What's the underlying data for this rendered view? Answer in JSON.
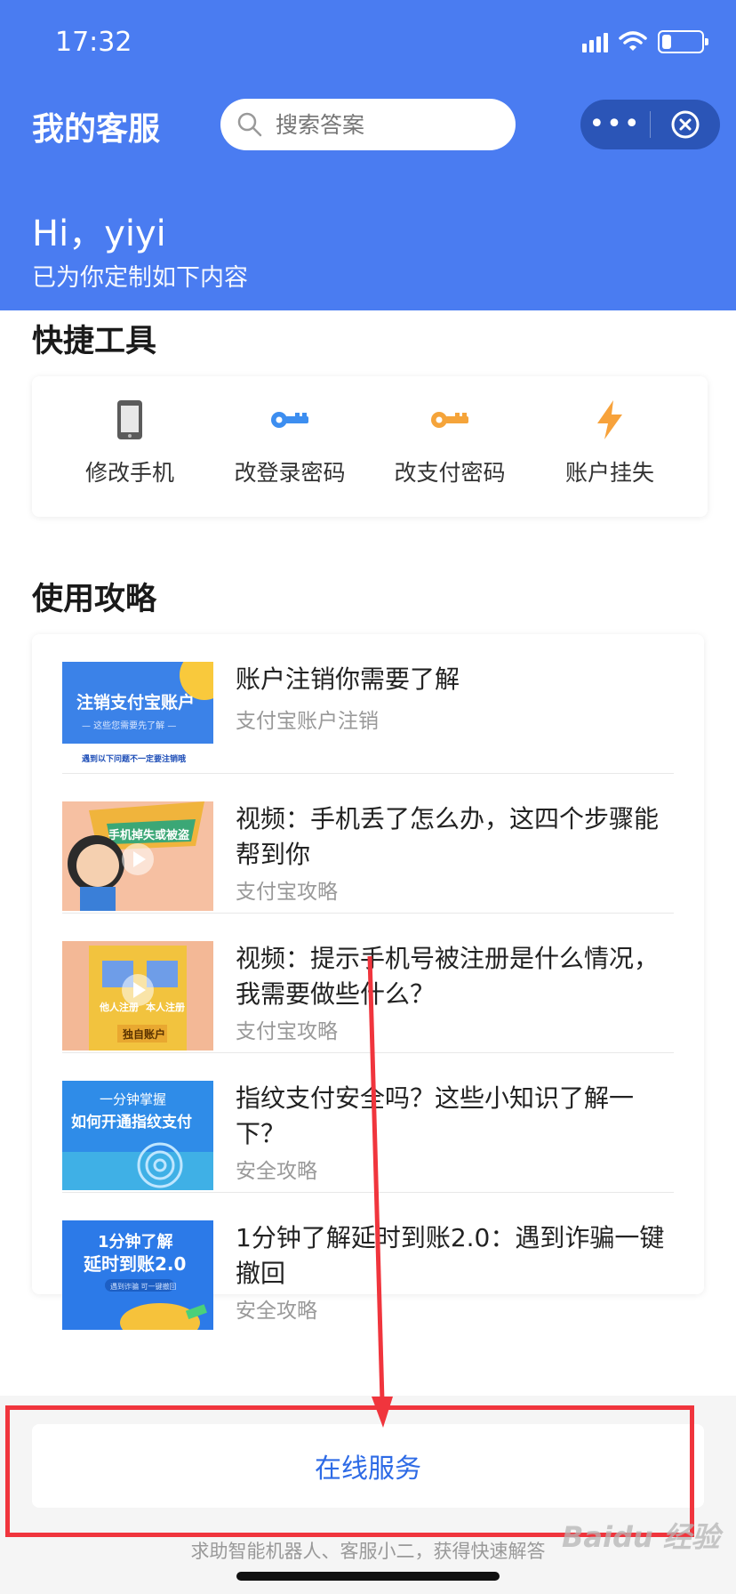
{
  "status_bar": {
    "time": "17:32"
  },
  "header": {
    "title": "我的客服",
    "search_placeholder": "搜索答案",
    "more_label": "•••"
  },
  "greeting": {
    "hello": "Hi，yiyi",
    "subtitle": "已为你定制如下内容"
  },
  "quick_tools": {
    "section_title": "快捷工具",
    "items": [
      {
        "label": "修改手机",
        "icon": "phone-icon"
      },
      {
        "label": "改登录密码",
        "icon": "key-icon"
      },
      {
        "label": "改支付密码",
        "icon": "key-icon"
      },
      {
        "label": "账户挂失",
        "icon": "lightning-icon"
      }
    ]
  },
  "guides": {
    "section_title": "使用攻略",
    "items": [
      {
        "title": "账户注销你需要了解",
        "category": "支付宝账户注销",
        "thumb": {
          "line1": "注销支付宝账户",
          "line2": "— 这些您需要先了解 —",
          "line3": "遇到以下问题不一定要注销哦"
        }
      },
      {
        "title": "视频：手机丢了怎么办，这四个步骤能帮到你",
        "category": "支付宝攻略",
        "thumb": {
          "line1": "手机掉失或被盗"
        }
      },
      {
        "title": "视频：提示手机号被注册是什么情况，我需要做些什么？",
        "category": "支付宝攻略",
        "thumb": {
          "line1": "他人注册",
          "line2": "本人注册",
          "line3": "独自账户"
        }
      },
      {
        "title": "指纹支付安全吗？这些小知识了解一下？",
        "category": "安全攻略",
        "thumb": {
          "line1": "一分钟掌握",
          "line2": "如何开通指纹支付"
        }
      },
      {
        "title": "1分钟了解延时到账2.0：遇到诈骗一键撤回",
        "category": "安全攻略",
        "thumb": {
          "line1": "1分钟了解",
          "line2": "延时到账2.0",
          "line3": "遇到诈骗 可一键撤回"
        }
      }
    ]
  },
  "online_service": {
    "label": "在线服务"
  },
  "footer": {
    "text": "求助智能机器人、客服小二，获得快速解答"
  },
  "watermark": "Baidu 经验",
  "colors": {
    "header_bg": "#4a7cf1",
    "accent": "#2e6be6",
    "annotation_red": "#f0353d"
  }
}
